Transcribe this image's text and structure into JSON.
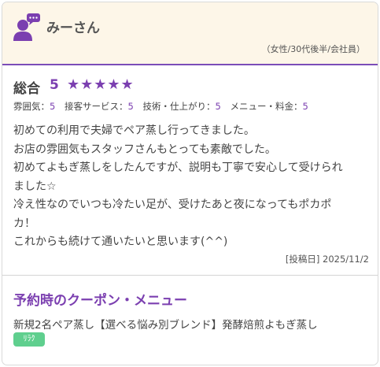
{
  "reviewer": {
    "name": "みーさん",
    "profile": "（女性/30代後半/会社員）"
  },
  "rating": {
    "label": "総合",
    "score": "5",
    "stars": "★★★★★",
    "star_count": 5
  },
  "sub_ratings": [
    {
      "label": "雰囲気：",
      "value": "5"
    },
    {
      "label": "接客サービス：",
      "value": "5"
    },
    {
      "label": "技術・仕上がり：",
      "value": "5"
    },
    {
      "label": "メニュー・料金：",
      "value": "5"
    }
  ],
  "review": {
    "lines": [
      "初めての利用で夫婦でペア蒸し行ってきました。",
      "お店の雰囲気もスタッフさんもとっても素敵でした。",
      "初めてよもぎ蒸しをしたんですが、説明も丁寧で安心して受けられ",
      "ました☆",
      "冷え性なのでいつも冷たい足が、受けたあと夜になってもポカポ",
      "カ！",
      "これからも続けて通いたいと思います(^^)"
    ],
    "post_date": "[投稿日] 2025/11/2"
  },
  "coupon": {
    "heading": "予約時のクーポン・メニュー",
    "text": "新規2名ペア蒸し【選べる悩み別ブレンド】発酵焙煎よもぎ蒸し",
    "badge": "ﾘﾗｸ"
  },
  "colors": {
    "accent": "#7b3fb0",
    "header_bg": "#fdf6e8",
    "badge_bg": "#5fcf8e"
  },
  "icons": {
    "avatar": "user-chat-icon"
  }
}
